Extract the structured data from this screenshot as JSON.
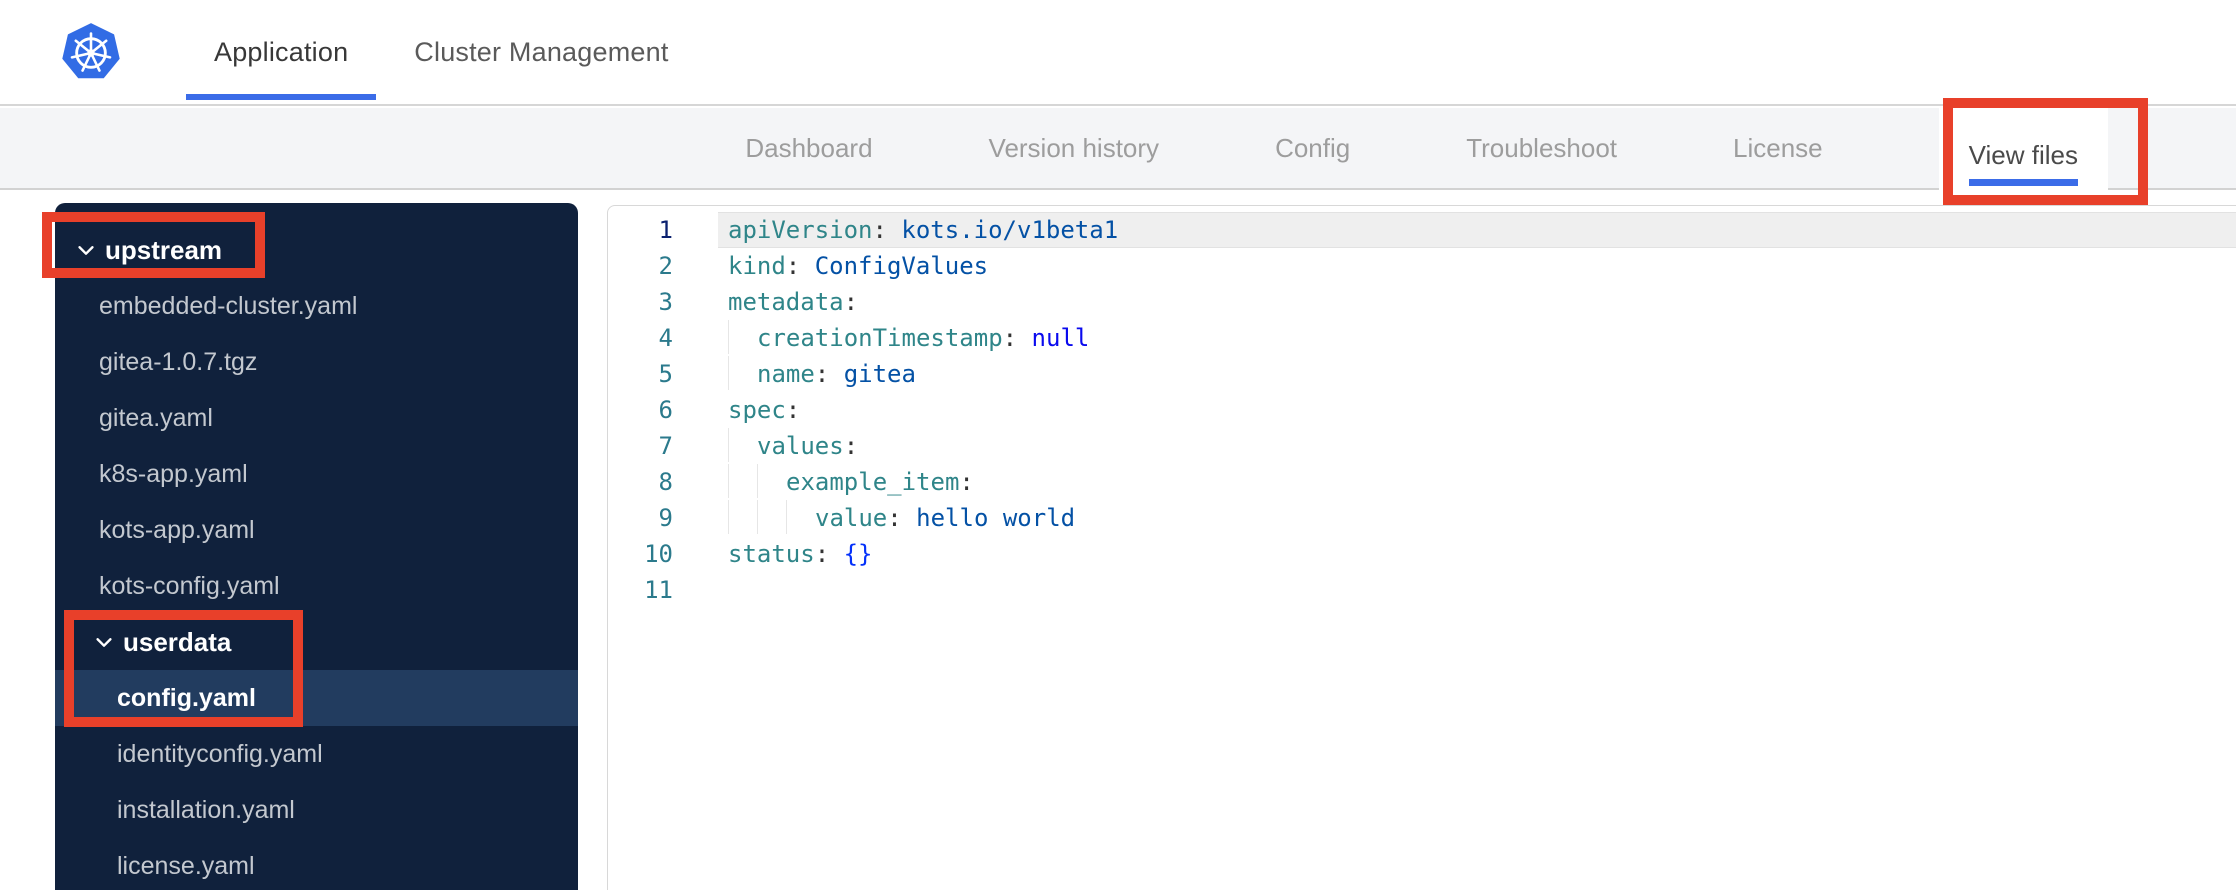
{
  "topbar": {
    "logo": "kubernetes-logo",
    "tabs": [
      {
        "label": "Application",
        "active": true
      },
      {
        "label": "Cluster Management",
        "active": false
      }
    ]
  },
  "subnav": {
    "items": [
      {
        "label": "Dashboard",
        "active": false
      },
      {
        "label": "Version history",
        "active": false
      },
      {
        "label": "Config",
        "active": false
      },
      {
        "label": "Troubleshoot",
        "active": false
      },
      {
        "label": "License",
        "active": false
      },
      {
        "label": "View files",
        "active": true
      }
    ]
  },
  "sidebar": {
    "items": [
      {
        "label": "upstream",
        "type": "folder",
        "level": 0,
        "expanded": true,
        "selected": false
      },
      {
        "label": "embedded-cluster.yaml",
        "type": "file",
        "level": 1,
        "selected": false
      },
      {
        "label": "gitea-1.0.7.tgz",
        "type": "file",
        "level": 1,
        "selected": false
      },
      {
        "label": "gitea.yaml",
        "type": "file",
        "level": 1,
        "selected": false
      },
      {
        "label": "k8s-app.yaml",
        "type": "file",
        "level": 1,
        "selected": false
      },
      {
        "label": "kots-app.yaml",
        "type": "file",
        "level": 1,
        "selected": false
      },
      {
        "label": "kots-config.yaml",
        "type": "file",
        "level": 1,
        "selected": false
      },
      {
        "label": "userdata",
        "type": "folder",
        "level": 1,
        "expanded": true,
        "selected": false
      },
      {
        "label": "config.yaml",
        "type": "file",
        "level": 2,
        "selected": true
      },
      {
        "label": "identityconfig.yaml",
        "type": "file",
        "level": 2,
        "selected": false
      },
      {
        "label": "installation.yaml",
        "type": "file",
        "level": 2,
        "selected": false
      },
      {
        "label": "license.yaml",
        "type": "file",
        "level": 2,
        "selected": false
      }
    ]
  },
  "editor": {
    "language": "yaml",
    "lines": [
      {
        "n": 1,
        "active": true,
        "indent": 0,
        "tokens": [
          {
            "t": "key",
            "s": "apiVersion"
          },
          {
            "t": "punc",
            "s": ": "
          },
          {
            "t": "val",
            "s": "kots.io/v1beta1"
          }
        ]
      },
      {
        "n": 2,
        "active": false,
        "indent": 0,
        "tokens": [
          {
            "t": "key",
            "s": "kind"
          },
          {
            "t": "punc",
            "s": ": "
          },
          {
            "t": "val",
            "s": "ConfigValues"
          }
        ]
      },
      {
        "n": 3,
        "active": false,
        "indent": 0,
        "tokens": [
          {
            "t": "key",
            "s": "metadata"
          },
          {
            "t": "punc",
            "s": ":"
          }
        ]
      },
      {
        "n": 4,
        "active": false,
        "indent": 1,
        "tokens": [
          {
            "t": "key",
            "s": "creationTimestamp"
          },
          {
            "t": "punc",
            "s": ": "
          },
          {
            "t": "null",
            "s": "null"
          }
        ]
      },
      {
        "n": 5,
        "active": false,
        "indent": 1,
        "tokens": [
          {
            "t": "key",
            "s": "name"
          },
          {
            "t": "punc",
            "s": ": "
          },
          {
            "t": "val",
            "s": "gitea"
          }
        ]
      },
      {
        "n": 6,
        "active": false,
        "indent": 0,
        "tokens": [
          {
            "t": "key",
            "s": "spec"
          },
          {
            "t": "punc",
            "s": ":"
          }
        ]
      },
      {
        "n": 7,
        "active": false,
        "indent": 1,
        "tokens": [
          {
            "t": "key",
            "s": "values"
          },
          {
            "t": "punc",
            "s": ":"
          }
        ]
      },
      {
        "n": 8,
        "active": false,
        "indent": 2,
        "tokens": [
          {
            "t": "key",
            "s": "example_item"
          },
          {
            "t": "punc",
            "s": ":"
          }
        ]
      },
      {
        "n": 9,
        "active": false,
        "indent": 3,
        "tokens": [
          {
            "t": "key",
            "s": "value"
          },
          {
            "t": "punc",
            "s": ": "
          },
          {
            "t": "val",
            "s": "hello world"
          }
        ]
      },
      {
        "n": 10,
        "active": false,
        "indent": 0,
        "tokens": [
          {
            "t": "key",
            "s": "status"
          },
          {
            "t": "punc",
            "s": ": "
          },
          {
            "t": "bracket",
            "s": "{}"
          }
        ]
      },
      {
        "n": 11,
        "active": false,
        "indent": 0,
        "tokens": []
      }
    ]
  },
  "annotations": [
    {
      "target": "view-files-tab"
    },
    {
      "target": "upstream-folder"
    },
    {
      "target": "userdata-folder-and-config-yaml"
    }
  ],
  "colors": {
    "accent_blue": "#3B6CE8",
    "kubernetes_blue": "#326CE5",
    "annotation_red": "#E8402A",
    "sidebar_bg": "#10213C",
    "sidebar_selected": "#223C5F",
    "yaml_key": "#2F8589",
    "yaml_value": "#0451A5",
    "yaml_null": "#0A0AEE",
    "yaml_bracket": "#0431FA",
    "line_number": "#2B7A8C",
    "line_number_active": "#0B216F"
  }
}
